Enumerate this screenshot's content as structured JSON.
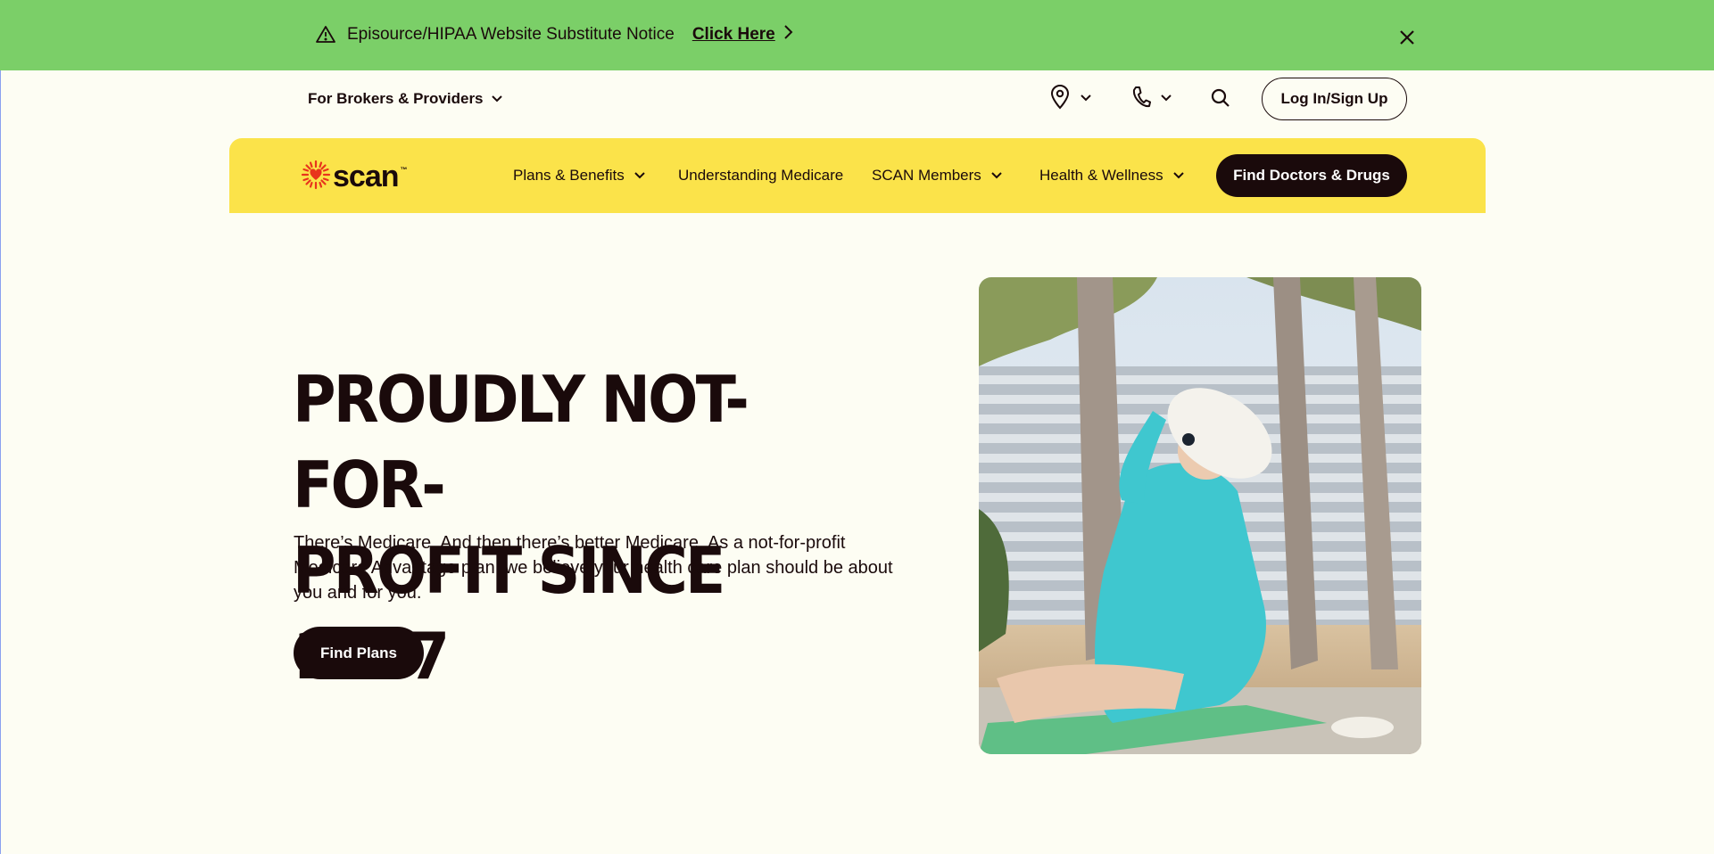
{
  "alert": {
    "message": "Episource/HIPAA Website Substitute Notice",
    "link_label": "Click Here"
  },
  "utility": {
    "brokers_label": "For Brokers & Providers",
    "login_label": "Log In/Sign Up"
  },
  "nav": {
    "logo_text": "scan",
    "logo_tm": "™",
    "items": [
      {
        "label": "Plans & Benefits"
      },
      {
        "label": "Understanding Medicare"
      },
      {
        "label": "SCAN Members"
      },
      {
        "label": "Health & Wellness"
      }
    ],
    "cta_label": "Find Doctors & Drugs"
  },
  "hero": {
    "title_line1": "PROUDLY NOT-FOR-",
    "title_line2": "PROFIT SINCE 1977",
    "body": "There’s Medicare. And then there’s better Medicare. As a not-for-profit Medicare Advantage plan, we believe your health care plan should be about you and for you.",
    "cta_label": "Find Plans"
  },
  "colors": {
    "alert_bg": "#7bcf68",
    "nav_bg": "#fbe34a",
    "page_bg": "#fdfdf3",
    "ink": "#1a0a0b",
    "logo_red": "#e8341c"
  },
  "icons": {
    "alert": "warning-triangle-icon",
    "close": "close-icon",
    "location": "location-pin-icon",
    "phone": "phone-icon",
    "search": "search-icon",
    "chevron": "chevron-down-icon"
  }
}
